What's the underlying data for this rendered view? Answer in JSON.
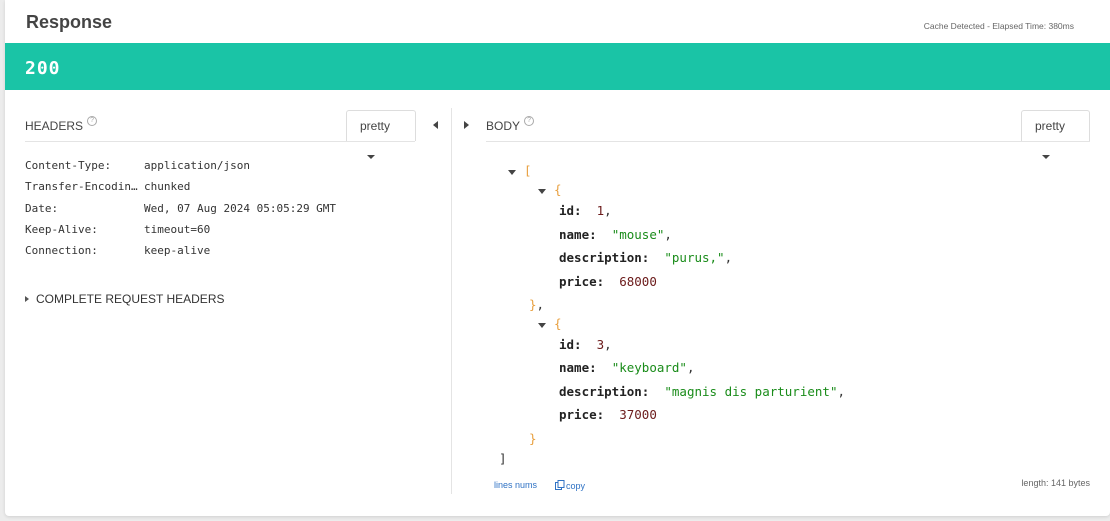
{
  "header": {
    "title": "Response",
    "cache_info": "Cache Detected - Elapsed Time: 380ms"
  },
  "status": {
    "code": "200",
    "color": "#1ac4a6"
  },
  "headers_section": {
    "label": "HEADERS",
    "format": "pretty",
    "rows": [
      {
        "name": "Content-Type:",
        "value": "application/json"
      },
      {
        "name": "Transfer-Encoding:",
        "value": "chunked"
      },
      {
        "name": "Date:",
        "value": "Wed, 07 Aug 2024 05:05:29 GMT"
      },
      {
        "name": "Keep-Alive:",
        "value": "timeout=60"
      },
      {
        "name": "Connection:",
        "value": "keep-alive"
      }
    ],
    "complete_label": "COMPLETE REQUEST HEADERS"
  },
  "body_section": {
    "label": "BODY",
    "format": "pretty",
    "items": [
      {
        "id": "1",
        "name": "\"mouse\"",
        "description": "\"purus,\"",
        "price": "68000"
      },
      {
        "id": "3",
        "name": "\"keyboard\"",
        "description": "\"magnis dis parturient\"",
        "price": "37000"
      }
    ],
    "keys": {
      "id": "id:",
      "name": "name:",
      "description": "description:",
      "price": "price:"
    },
    "footer": {
      "lines_nums": "lines nums",
      "copy": "copy",
      "length": "length: 141 bytes"
    }
  }
}
